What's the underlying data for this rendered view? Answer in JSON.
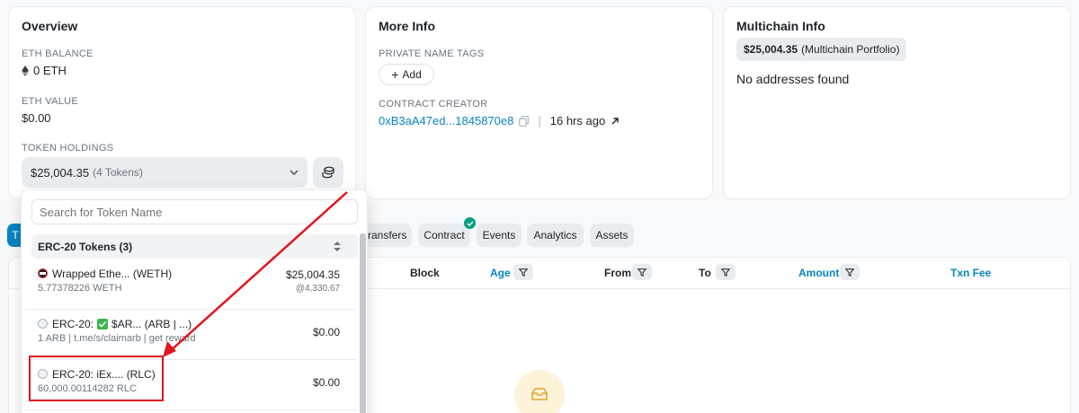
{
  "overview": {
    "title": "Overview",
    "eth_balance_label": "ETH BALANCE",
    "eth_balance_value": "0 ETH",
    "eth_value_label": "ETH VALUE",
    "eth_value": "$0.00",
    "token_holdings_label": "TOKEN HOLDINGS",
    "token_holdings_value": "$25,004.35",
    "token_holdings_count": "(4 Tokens)"
  },
  "more_info": {
    "title": "More Info",
    "private_tags_label": "PRIVATE NAME TAGS",
    "add_label": "Add",
    "contract_creator_label": "CONTRACT CREATOR",
    "creator_address": "0xB3aA47ed...1845870e8",
    "separator": "|",
    "creator_age": "16 hrs ago"
  },
  "multichain": {
    "title": "Multichain Info",
    "portfolio_value": "$25,004.35",
    "portfolio_label": "(Multichain Portfolio)",
    "no_addresses": "No addresses found"
  },
  "tabs": [
    {
      "label": "T"
    },
    {
      "label": "ransfers"
    },
    {
      "label": "Contract"
    },
    {
      "label": "Events"
    },
    {
      "label": "Analytics"
    },
    {
      "label": "Assets"
    }
  ],
  "table": {
    "headers": {
      "block": "Block",
      "age": "Age",
      "from": "From",
      "to": "To",
      "amount": "Amount",
      "txn_fee": "Txn Fee"
    }
  },
  "dropdown": {
    "search_placeholder": "Search for Token Name",
    "group_label": "ERC-20 Tokens (3)",
    "tokens": [
      {
        "name": "Wrapped Ethe... (WETH)",
        "balance": "5.77378226 WETH",
        "value": "$25,004.35",
        "price": "@4,330.67"
      },
      {
        "prefix": "ERC-20:",
        "name": "$AR... (ARB | ...)",
        "balance": "1 ARB | t.me/s/claimarb | get reward",
        "value": "$0.00"
      },
      {
        "name": "ERC-20: iEx.... (RLC)",
        "balance": "60,000.00114282 RLC",
        "value": "$0.00"
      }
    ]
  },
  "colors": {
    "link": "#0784c3",
    "accent_tab": "#0784c3",
    "annotation": "#e0161e",
    "verified": "#00a186"
  }
}
